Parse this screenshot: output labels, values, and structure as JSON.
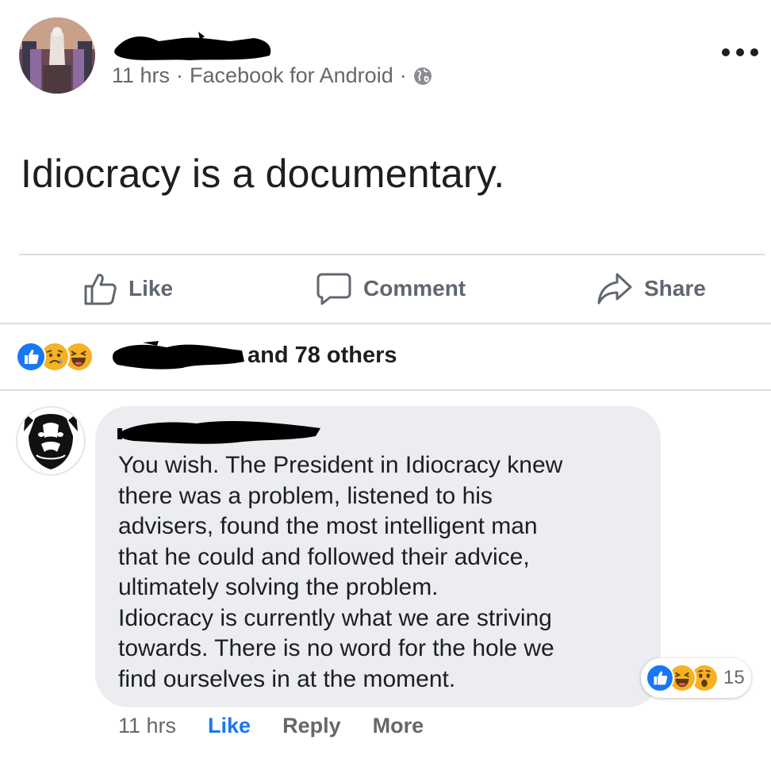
{
  "post": {
    "time": "11 hrs",
    "source": "Facebook for Android",
    "separator": "·",
    "text": "Idiocracy is a documentary."
  },
  "actions": {
    "like": "Like",
    "comment": "Comment",
    "share": "Share"
  },
  "reactions": {
    "others_text": "and 78 others",
    "icons": [
      "like-icon",
      "sad-icon",
      "haha-icon"
    ]
  },
  "comment": {
    "text": "You wish. The President in Idiocracy knew\nthere was a problem, listened to his\nadvisers, found the most intelligent man\nthat he could and followed their advice,\nultimately solving the problem.\nIdiocracy is currently what we are striving\ntowards. There is no word for the hole we\nfind ourselves in at the moment.",
    "reaction_count": "15",
    "reaction_icons": [
      "like-icon",
      "haha-icon",
      "wow-icon"
    ],
    "time": "11 hrs",
    "like": "Like",
    "reply": "Reply",
    "more": "More"
  },
  "colors": {
    "brand_blue": "#1877f2",
    "bubble_bg": "#ebedf0",
    "secondary_text": "#65676b",
    "reaction_yellow": "#f7b125"
  }
}
